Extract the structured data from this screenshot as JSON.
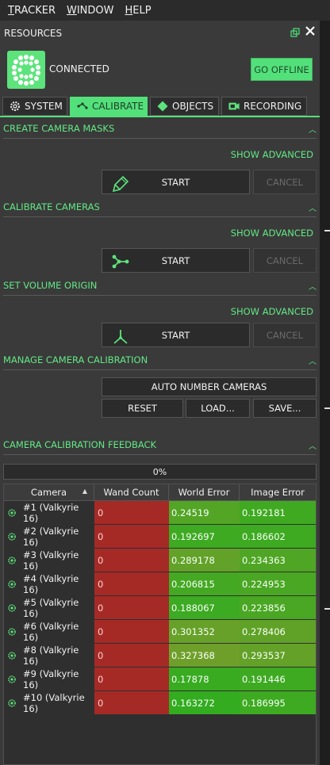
{
  "menu": [
    "TRACKER",
    "WINDOW",
    "HELP"
  ],
  "panel": {
    "title": "RESOURCES"
  },
  "connection": {
    "status": "CONNECTED",
    "go_offline_label": "GO OFFLINE"
  },
  "tabs": [
    {
      "label": "SYSTEM",
      "icon": "gear-icon",
      "active": false
    },
    {
      "label": "CALIBRATE",
      "icon": "wand-icon",
      "active": true
    },
    {
      "label": "OBJECTS",
      "icon": "diamond-icon",
      "active": false
    },
    {
      "label": "RECORDING",
      "icon": "video-camera-icon",
      "active": false
    }
  ],
  "sections": {
    "masks": {
      "title": "CREATE CAMERA MASKS",
      "advanced": "SHOW ADVANCED",
      "start": "START",
      "cancel": "CANCEL"
    },
    "calibrate": {
      "title": "CALIBRATE CAMERAS",
      "advanced": "SHOW ADVANCED",
      "start": "START",
      "cancel": "CANCEL"
    },
    "origin": {
      "title": "SET VOLUME ORIGIN",
      "advanced": "SHOW ADVANCED",
      "start": "START",
      "cancel": "CANCEL"
    },
    "manage": {
      "title": "MANAGE CAMERA CALIBRATION",
      "auto_number": "AUTO NUMBER CAMERAS",
      "reset": "RESET",
      "load": "LOAD...",
      "save": "SAVE..."
    },
    "feedback": {
      "title": "CAMERA CALIBRATION FEEDBACK",
      "progress": "0%"
    }
  },
  "table": {
    "headers": [
      "Camera",
      "Wand Count",
      "World Error",
      "Image Error"
    ],
    "sort_indicator": "▲",
    "rows": [
      {
        "camera": "#1 (Valkyrie 16)",
        "wand": "0",
        "world": "0.24519",
        "image": "0.192181",
        "world_color": "#53a526",
        "image_color": "#3faa21"
      },
      {
        "camera": "#2 (Valkyrie 16)",
        "wand": "0",
        "world": "0.192697",
        "image": "0.186602",
        "world_color": "#3eaa22",
        "image_color": "#3daa21"
      },
      {
        "camera": "#3 (Valkyrie 16)",
        "wand": "0",
        "world": "0.289178",
        "image": "0.234363",
        "world_color": "#62a228",
        "image_color": "#4fa624"
      },
      {
        "camera": "#4 (Valkyrie 16)",
        "wand": "0",
        "world": "0.206815",
        "image": "0.224953",
        "world_color": "#44a823",
        "image_color": "#4aa723"
      },
      {
        "camera": "#5 (Valkyrie 16)",
        "wand": "0",
        "world": "0.188067",
        "image": "0.223856",
        "world_color": "#3caa22",
        "image_color": "#4aa723"
      },
      {
        "camera": "#6 (Valkyrie 16)",
        "wand": "0",
        "world": "0.301352",
        "image": "0.278406",
        "world_color": "#67a129",
        "image_color": "#60a227"
      },
      {
        "camera": "#8 (Valkyrie 16)",
        "wand": "0",
        "world": "0.327368",
        "image": "0.293537",
        "world_color": "#6f9f2b",
        "image_color": "#64a128"
      },
      {
        "camera": "#9 (Valkyrie 16)",
        "wand": "0",
        "world": "0.17878",
        "image": "0.191446",
        "world_color": "#38ab21",
        "image_color": "#3eaa22"
      },
      {
        "camera": "#10 (Valkyrie 16)",
        "wand": "0",
        "world": "0.163272",
        "image": "0.186995",
        "world_color": "#33ac20",
        "image_color": "#3daa21"
      }
    ]
  },
  "colors": {
    "accent": "#53e07b",
    "wand_bad": "#a52a26"
  }
}
